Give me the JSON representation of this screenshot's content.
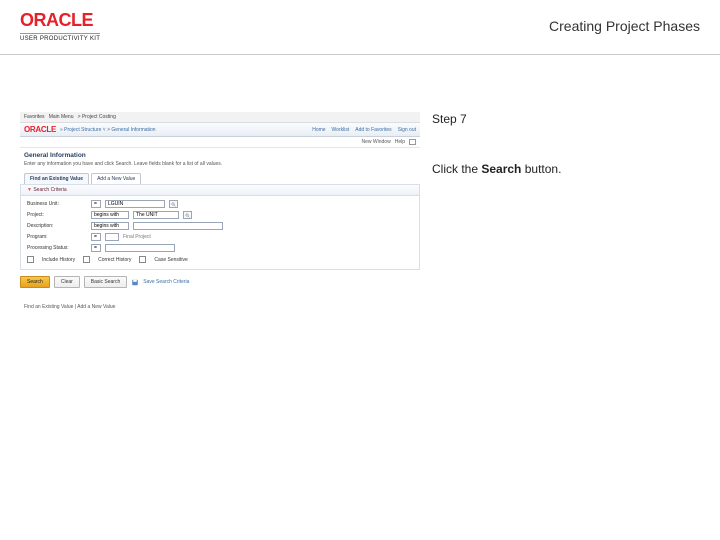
{
  "header": {
    "brand": "ORACLE",
    "brand_sub": "USER PRODUCTIVITY KIT",
    "page_title": "Creating Project Phases"
  },
  "instruction": {
    "step_label": "Step 7",
    "body_pre": "Click the ",
    "body_bold": "Search",
    "body_post": " button."
  },
  "app": {
    "nav_items": [
      "Favorites",
      "Main Menu",
      "Project Costing",
      "Project Structure",
      "General Information"
    ],
    "brand": "ORACLE",
    "breadcrumb_text": "» Project Structure ˅ > General Information",
    "bar_right": [
      "Home",
      "Worklist",
      "Add to Favorites",
      "Sign out"
    ],
    "subbar_label": "New Window",
    "subbar_help": "Help",
    "gi_title": "General Information",
    "gi_desc": "Enter any information you have and click Search. Leave fields blank for a list of all values.",
    "tabs": [
      {
        "label": "Find an Existing Value",
        "active": true
      },
      {
        "label": "Add a New Value",
        "active": false
      }
    ],
    "panel_title": "Search Criteria",
    "rows": [
      {
        "label": "Business Unit:",
        "op": "=",
        "value": "LGUIN",
        "lookup": true
      },
      {
        "label": "Project:",
        "op": "begins with",
        "value": "The UNIT",
        "lookup": true
      },
      {
        "label": "Description:",
        "op": "begins with",
        "value": "",
        "lookup": false
      },
      {
        "label": "Program:",
        "op": "=",
        "value": "",
        "lookup": false
      },
      {
        "label": "Processing Status:",
        "op": "=",
        "value": "",
        "lookup": false
      }
    ],
    "status_hint": "Final Project",
    "options": [
      "Include History",
      "Correct History",
      "Case Sensitive"
    ],
    "buttons": {
      "search": "Search",
      "clear": "Clear",
      "basic": "Basic Search"
    },
    "saved_link": "Save Search Criteria",
    "footer_note": "Find an Existing Value | Add a New Value"
  }
}
